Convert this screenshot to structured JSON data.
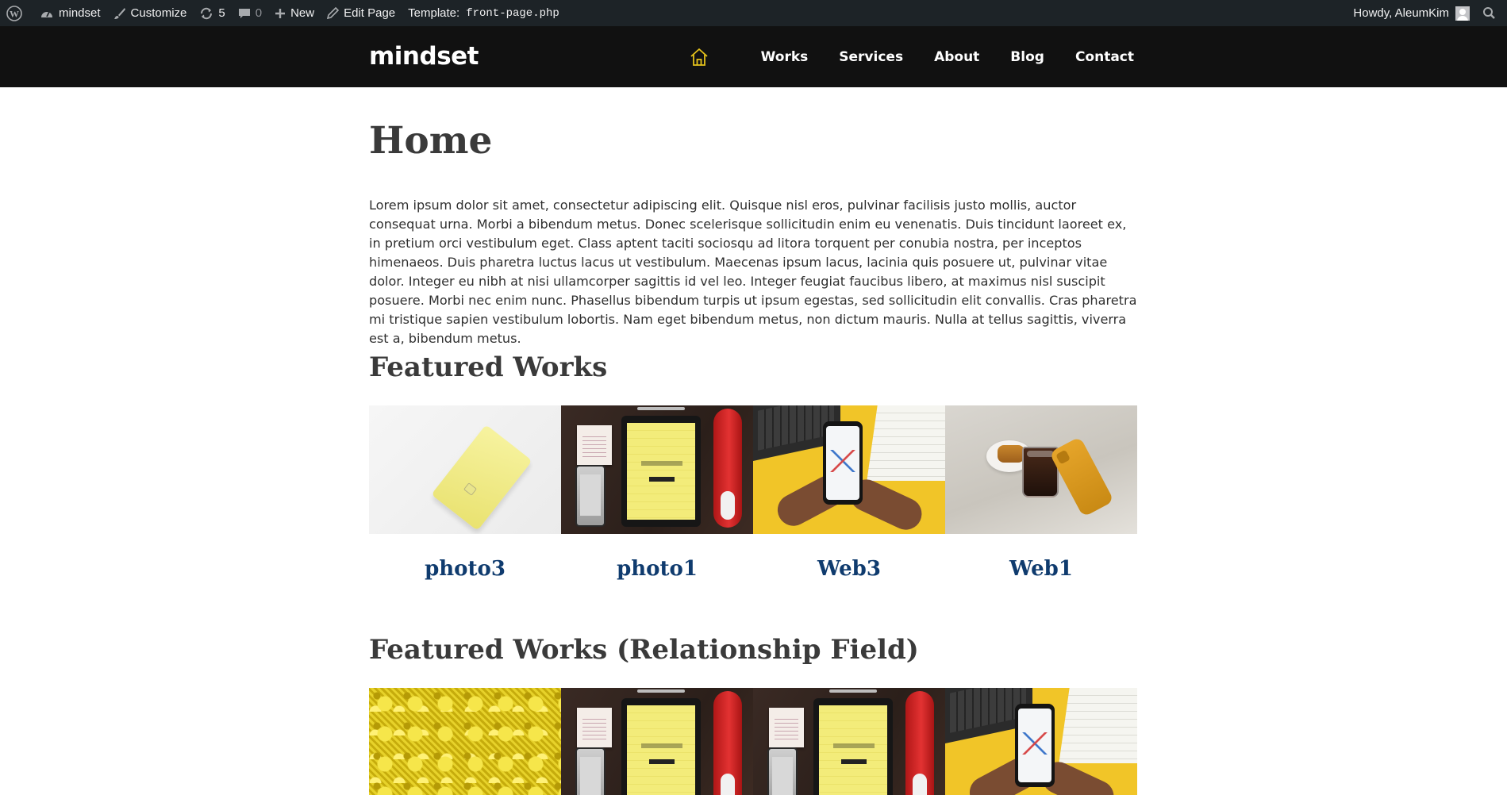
{
  "admin_bar": {
    "site_name": "mindset",
    "customize": "Customize",
    "updates_count": "5",
    "comments_count": "0",
    "new_label": "New",
    "edit_page": "Edit Page",
    "template_label": "Template:",
    "template_file": "front-page.php",
    "greeting": "Howdy, AleumKim"
  },
  "header": {
    "site_title": "mindset",
    "home_icon": "house-outline-icon",
    "home_icon_color": "#e5c21b",
    "nav": [
      "Works",
      "Services",
      "About",
      "Blog",
      "Contact"
    ]
  },
  "page": {
    "title": "Home",
    "intro": "Lorem ipsum dolor sit amet, consectetur adipiscing elit. Quisque nisl eros, pulvinar facilisis justo mollis, auctor consequat urna. Morbi a bibendum metus. Donec scelerisque sollicitudin enim eu venenatis. Duis tincidunt laoreet ex, in pretium orci vestibulum eget. Class aptent taciti sociosqu ad litora torquent per conubia nostra, per inceptos himenaeos. Duis pharetra luctus lacus ut vestibulum. Maecenas ipsum lacus, lacinia quis posuere ut, pulvinar vitae dolor. Integer eu nibh at nisi ullamcorper sagittis id vel leo. Integer feugiat faucibus libero, at maximus nisl suscipit posuere. Morbi nec enim nunc. Phasellus bibendum turpis ut ipsum egestas, sed sollicitudin elit convallis. Cras pharetra mi tristique sapien vestibulum lobortis. Nam eget bibendum metus, non dictum mauris. Nulla at tellus sagittis, viverra est a, bibendum metus."
  },
  "featured_works": {
    "title": "Featured Works",
    "items": [
      {
        "title": "photo3",
        "image": "yellow credit card on white"
      },
      {
        "title": "photo1",
        "image": "tablet with yellow screen on desk"
      },
      {
        "title": "Web3",
        "image": "hands holding phone with chart"
      },
      {
        "title": "Web1",
        "image": "iced coffee and yellow phone"
      }
    ]
  },
  "featured_works_relationship": {
    "title": "Featured Works (Relationship Field)",
    "items": [
      {
        "image": "yellow flowers"
      },
      {
        "image": "tablet with yellow screen on desk"
      },
      {
        "image": "tablet with yellow screen on desk"
      },
      {
        "image": "hands holding phone with chart"
      }
    ]
  },
  "colors": {
    "admin_bar_bg": "#1d2327",
    "header_bg": "#111111",
    "card_title": "#0f3b6e"
  }
}
